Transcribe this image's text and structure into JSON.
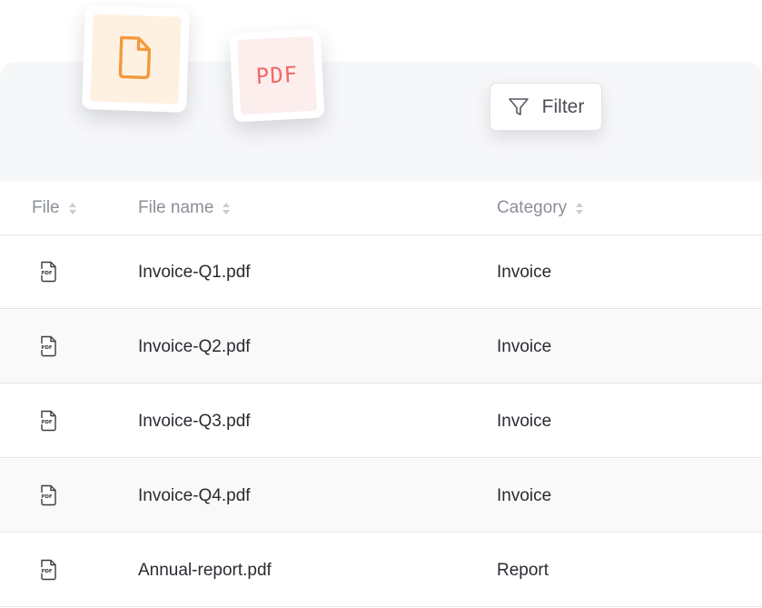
{
  "decor": {
    "pdf_card_text": "PDF",
    "icons": [
      "document-icon",
      "pdf-icon"
    ],
    "colors": {
      "orange": "#f29a3c",
      "red": "#ee6a6a"
    }
  },
  "toolbar": {
    "filter_label": "Filter",
    "filter_icon": "filter-funnel-icon"
  },
  "table": {
    "columns": [
      {
        "label": "File",
        "sortable": true
      },
      {
        "label": "File name",
        "sortable": true
      },
      {
        "label": "Category",
        "sortable": true
      }
    ],
    "rows": [
      {
        "file_icon": "pdf-file-icon",
        "name": "Invoice-Q1.pdf",
        "category": "Invoice"
      },
      {
        "file_icon": "pdf-file-icon",
        "name": "Invoice-Q2.pdf",
        "category": "Invoice"
      },
      {
        "file_icon": "pdf-file-icon",
        "name": "Invoice-Q3.pdf",
        "category": "Invoice"
      },
      {
        "file_icon": "pdf-file-icon",
        "name": "Invoice-Q4.pdf",
        "category": "Invoice"
      },
      {
        "file_icon": "pdf-file-icon",
        "name": "Annual-report.pdf",
        "category": "Report"
      }
    ]
  }
}
